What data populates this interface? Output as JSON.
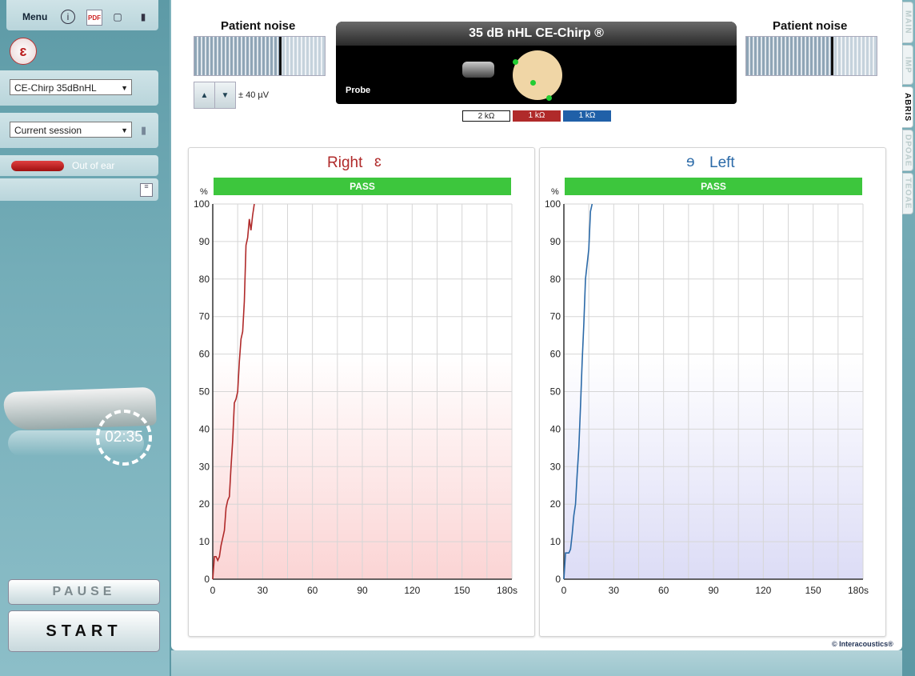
{
  "toolbar": {
    "menu_label": "Menu"
  },
  "sidebar": {
    "protocol_select": "CE-Chirp 35dBnHL",
    "session_select": "Current session",
    "probe_status": "Out of ear",
    "timer": "02:35",
    "pause_label": "PAUSE",
    "start_label": "START"
  },
  "header": {
    "noise_left_title": "Patient noise",
    "noise_right_title": "Patient noise",
    "noise_level": "± 40 µV",
    "stimulus_title": "35 dB nHL CE-Chirp ®",
    "probe_label": "Probe",
    "impedances": [
      "2 kΩ",
      "1 kΩ",
      "1 kΩ"
    ]
  },
  "tabs": [
    "MAIN",
    "IMP",
    "ABRIS",
    "DPOAE",
    "TEOAE"
  ],
  "active_tab": "ABRIS",
  "right_panel": {
    "title": "Right",
    "result": "PASS"
  },
  "left_panel": {
    "title": "Left",
    "result": "PASS"
  },
  "footer": {
    "brand": "© Interacoustics®"
  },
  "colors": {
    "right": "#b02a2a",
    "left": "#2b6aa8",
    "pass": "#3dc63d"
  },
  "chart_data": [
    {
      "type": "line",
      "title": "Right",
      "ylabel": "%",
      "xlim": [
        0,
        180
      ],
      "ylim": [
        0,
        100
      ],
      "x_ticks": [
        "0",
        "30",
        "60",
        "90",
        "120",
        "150",
        "180s"
      ],
      "y_ticks": [
        "0",
        "10",
        "20",
        "30",
        "40",
        "50",
        "60",
        "70",
        "80",
        "90",
        "100"
      ],
      "series": [
        {
          "x": [
            0,
            1,
            2,
            3,
            4,
            5,
            6,
            7,
            8,
            9,
            10,
            11,
            12,
            13,
            14,
            15,
            16,
            17,
            18,
            19,
            20,
            21,
            22,
            23,
            24,
            25
          ],
          "y": [
            0,
            6,
            6,
            5,
            6,
            9,
            11,
            13,
            19,
            21,
            22,
            30,
            37,
            47,
            48,
            50,
            58,
            64,
            66,
            74,
            89,
            91,
            96,
            93,
            97,
            100
          ]
        }
      ]
    },
    {
      "type": "line",
      "title": "Left",
      "ylabel": "%",
      "xlim": [
        0,
        180
      ],
      "ylim": [
        0,
        100
      ],
      "x_ticks": [
        "0",
        "30",
        "60",
        "90",
        "120",
        "150",
        "180s"
      ],
      "y_ticks": [
        "0",
        "10",
        "20",
        "30",
        "40",
        "50",
        "60",
        "70",
        "80",
        "90",
        "100"
      ],
      "series": [
        {
          "x": [
            0,
            1,
            2,
            3,
            4,
            5,
            6,
            7,
            8,
            9,
            10,
            11,
            12,
            13,
            14,
            15,
            16,
            17
          ],
          "y": [
            0,
            7,
            7,
            7,
            8,
            12,
            17,
            20,
            28,
            35,
            46,
            58,
            68,
            80,
            84,
            88,
            98,
            100
          ]
        }
      ]
    }
  ]
}
